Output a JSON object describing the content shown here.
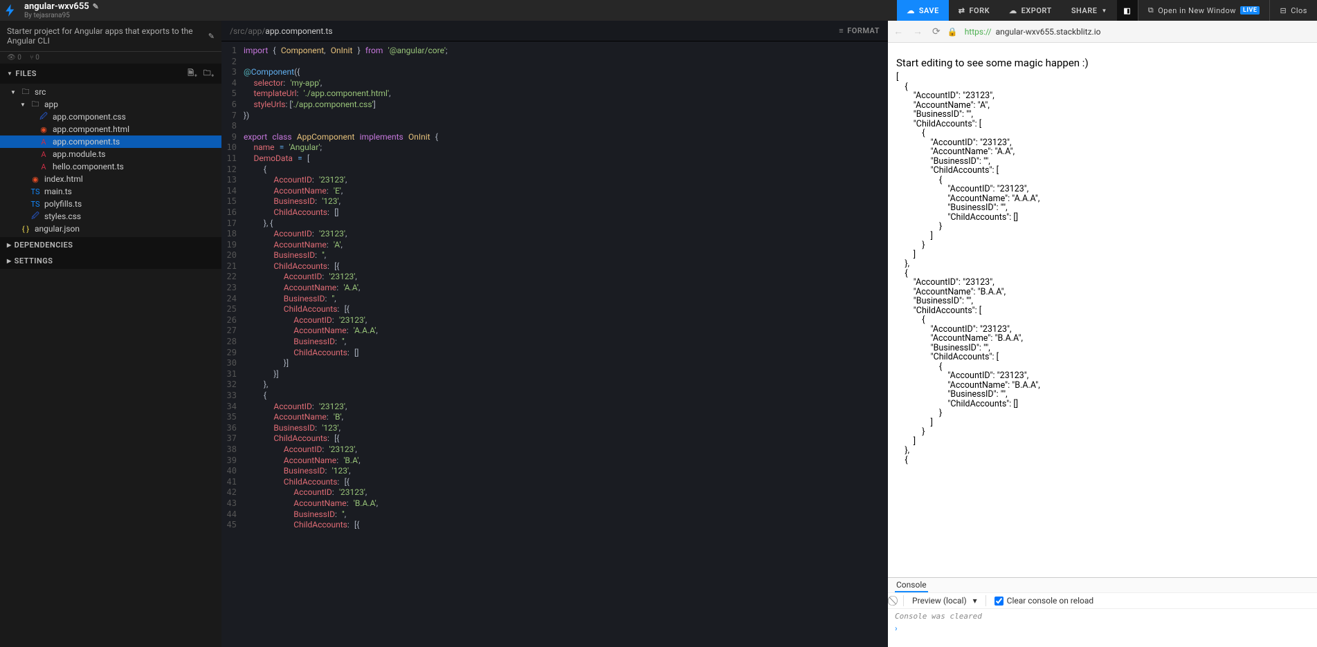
{
  "project": {
    "name": "angular-wxv655",
    "author": "By tejasrana95",
    "description": "Starter project for Angular apps that exports to the Angular CLI",
    "views": "0",
    "forks": "0"
  },
  "toolbar": {
    "save": "SAVE",
    "fork": "FORK",
    "export": "EXPORT",
    "share": "SHARE",
    "openNew": "Open in New Window",
    "live": "LIVE",
    "close": "Clos"
  },
  "sidebar": {
    "files_label": "FILES",
    "deps_label": "DEPENDENCIES",
    "settings_label": "SETTINGS",
    "tree": [
      {
        "depth": 0,
        "type": "dir",
        "open": true,
        "name": "src"
      },
      {
        "depth": 1,
        "type": "dir",
        "open": true,
        "name": "app"
      },
      {
        "depth": 2,
        "type": "file",
        "icon": "css",
        "name": "app.component.css"
      },
      {
        "depth": 2,
        "type": "file",
        "icon": "html",
        "name": "app.component.html"
      },
      {
        "depth": 2,
        "type": "file",
        "icon": "tsA",
        "name": "app.component.ts",
        "active": true
      },
      {
        "depth": 2,
        "type": "file",
        "icon": "tsA",
        "name": "app.module.ts"
      },
      {
        "depth": 2,
        "type": "file",
        "icon": "tsA",
        "name": "hello.component.ts"
      },
      {
        "depth": 1,
        "type": "file",
        "icon": "html",
        "name": "index.html"
      },
      {
        "depth": 1,
        "type": "file",
        "icon": "ts",
        "name": "main.ts"
      },
      {
        "depth": 1,
        "type": "file",
        "icon": "ts",
        "name": "polyfills.ts"
      },
      {
        "depth": 1,
        "type": "file",
        "icon": "css",
        "name": "styles.css"
      },
      {
        "depth": 0,
        "type": "file",
        "icon": "json",
        "name": "angular.json"
      }
    ]
  },
  "editor": {
    "crumb_dim": "/src/app/",
    "crumb_cur": "app.component.ts",
    "format": "FORMAT",
    "line_count": 45,
    "code_html": "<span class='tok-kw'>import</span> <span class='tok-p'>{</span> <span class='tok-id'>Component</span><span class='tok-p'>,</span> <span class='tok-id'>OnInit</span> <span class='tok-p'>}</span> <span class='tok-kw'>from</span> <span class='tok-str'>'@angular/core'</span><span class='tok-p'>;</span>\n\n<span class='tok-dec'>@</span><span class='tok-fn'>Component</span><span class='tok-p'>({</span>\n  <span class='tok-prop'>selector</span><span class='tok-p'>:</span> <span class='tok-str'>'my-app'</span><span class='tok-p'>,</span>\n  <span class='tok-prop'>templateUrl</span><span class='tok-p'>:</span> <span class='tok-str'>'./app.component.html'</span><span class='tok-p'>,</span>\n  <span class='tok-prop'>styleUrls</span><span class='tok-p'>: [</span><span class='tok-str'>'./app.component.css'</span><span class='tok-p'>]</span>\n<span class='tok-p'>})</span>\n\n<span class='tok-kw'>export</span> <span class='tok-kw'>class</span> <span class='tok-id'>AppComponent</span> <span class='tok-kw'>implements</span> <span class='tok-id'>OnInit</span> <span class='tok-p'>{</span>\n  <span class='tok-prop'>name</span> <span class='tok-op'>=</span> <span class='tok-str'>'Angular'</span><span class='tok-p'>;</span>\n  <span class='tok-prop'>DemoData</span> <span class='tok-op'>=</span> <span class='tok-p'>[</span>\n    <span class='tok-p'>{</span>\n      <span class='tok-prop'>AccountID</span><span class='tok-p'>:</span> <span class='tok-str'>'23123'</span><span class='tok-p'>,</span>\n      <span class='tok-prop'>AccountName</span><span class='tok-p'>:</span> <span class='tok-str'>'E'</span><span class='tok-p'>,</span>\n      <span class='tok-prop'>BusinessID</span><span class='tok-p'>:</span> <span class='tok-str'>'123'</span><span class='tok-p'>,</span>\n      <span class='tok-prop'>ChildAccounts</span><span class='tok-p'>:</span> <span class='tok-p'>[]</span>\n    <span class='tok-p'>}, {</span>\n      <span class='tok-prop'>AccountID</span><span class='tok-p'>:</span> <span class='tok-str'>'23123'</span><span class='tok-p'>,</span>\n      <span class='tok-prop'>AccountName</span><span class='tok-p'>:</span> <span class='tok-str'>'A'</span><span class='tok-p'>,</span>\n      <span class='tok-prop'>BusinessID</span><span class='tok-p'>:</span> <span class='tok-str'>''</span><span class='tok-p'>,</span>\n      <span class='tok-prop'>ChildAccounts</span><span class='tok-p'>:</span> <span class='tok-p'>[{</span>\n        <span class='tok-prop'>AccountID</span><span class='tok-p'>:</span> <span class='tok-str'>'23123'</span><span class='tok-p'>,</span>\n        <span class='tok-prop'>AccountName</span><span class='tok-p'>:</span> <span class='tok-str'>'A.A'</span><span class='tok-p'>,</span>\n        <span class='tok-prop'>BusinessID</span><span class='tok-p'>:</span> <span class='tok-str'>''</span><span class='tok-p'>,</span>\n        <span class='tok-prop'>ChildAccounts</span><span class='tok-p'>:</span> <span class='tok-p'>[{</span>\n          <span class='tok-prop'>AccountID</span><span class='tok-p'>:</span> <span class='tok-str'>'23123'</span><span class='tok-p'>,</span>\n          <span class='tok-prop'>AccountName</span><span class='tok-p'>:</span> <span class='tok-str'>'A.A.A'</span><span class='tok-p'>,</span>\n          <span class='tok-prop'>BusinessID</span><span class='tok-p'>:</span> <span class='tok-str'>''</span><span class='tok-p'>,</span>\n          <span class='tok-prop'>ChildAccounts</span><span class='tok-p'>:</span> <span class='tok-p'>[]</span>\n        <span class='tok-p'>}]</span>\n      <span class='tok-p'>}]</span>\n    <span class='tok-p'>},</span>\n    <span class='tok-p'>{</span>\n      <span class='tok-prop'>AccountID</span><span class='tok-p'>:</span> <span class='tok-str'>'23123'</span><span class='tok-p'>,</span>\n      <span class='tok-prop'>AccountName</span><span class='tok-p'>:</span> <span class='tok-str'>'B'</span><span class='tok-p'>,</span>\n      <span class='tok-prop'>BusinessID</span><span class='tok-p'>:</span> <span class='tok-str'>'123'</span><span class='tok-p'>,</span>\n      <span class='tok-prop'>ChildAccounts</span><span class='tok-p'>:</span> <span class='tok-p'>[{</span>\n        <span class='tok-prop'>AccountID</span><span class='tok-p'>:</span> <span class='tok-str'>'23123'</span><span class='tok-p'>,</span>\n        <span class='tok-prop'>AccountName</span><span class='tok-p'>:</span> <span class='tok-str'>'B.A'</span><span class='tok-p'>,</span>\n        <span class='tok-prop'>BusinessID</span><span class='tok-p'>:</span> <span class='tok-str'>'123'</span><span class='tok-p'>,</span>\n        <span class='tok-prop'>ChildAccounts</span><span class='tok-p'>:</span> <span class='tok-p'>[{</span>\n          <span class='tok-prop'>AccountID</span><span class='tok-p'>:</span> <span class='tok-str'>'23123'</span><span class='tok-p'>,</span>\n          <span class='tok-prop'>AccountName</span><span class='tok-p'>:</span> <span class='tok-str'>'B.A.A'</span><span class='tok-p'>,</span>\n          <span class='tok-prop'>BusinessID</span><span class='tok-p'>:</span> <span class='tok-str'>''</span><span class='tok-p'>,</span>\n          <span class='tok-prop'>ChildAccounts</span><span class='tok-p'>:</span> <span class='tok-p'>[{</span>"
  },
  "preview": {
    "url_proto": "https://",
    "url_rest": "angular-wxv655.stackblitz.io",
    "heading": "Start editing to see some magic happen :)",
    "json_output": "[\n    {\n        \"AccountID\": \"23123\",\n        \"AccountName\": \"A\",\n        \"BusinessID\": \"\",\n        \"ChildAccounts\": [\n            {\n                \"AccountID\": \"23123\",\n                \"AccountName\": \"A.A\",\n                \"BusinessID\": \"\",\n                \"ChildAccounts\": [\n                    {\n                        \"AccountID\": \"23123\",\n                        \"AccountName\": \"A.A.A\",\n                        \"BusinessID\": \"\",\n                        \"ChildAccounts\": []\n                    }\n                ]\n            }\n        ]\n    },\n    {\n        \"AccountID\": \"23123\",\n        \"AccountName\": \"B.A.A\",\n        \"BusinessID\": \"\",\n        \"ChildAccounts\": [\n            {\n                \"AccountID\": \"23123\",\n                \"AccountName\": \"B.A.A\",\n                \"BusinessID\": \"\",\n                \"ChildAccounts\": [\n                    {\n                        \"AccountID\": \"23123\",\n                        \"AccountName\": \"B.A.A\",\n                        \"BusinessID\": \"\",\n                        \"ChildAccounts\": []\n                    }\n                ]\n            }\n        ]\n    },\n    {"
  },
  "console": {
    "tab": "Console",
    "source": "Preview (local)",
    "clear_label": "Clear console on reload",
    "cleared_msg": "Console was cleared"
  }
}
